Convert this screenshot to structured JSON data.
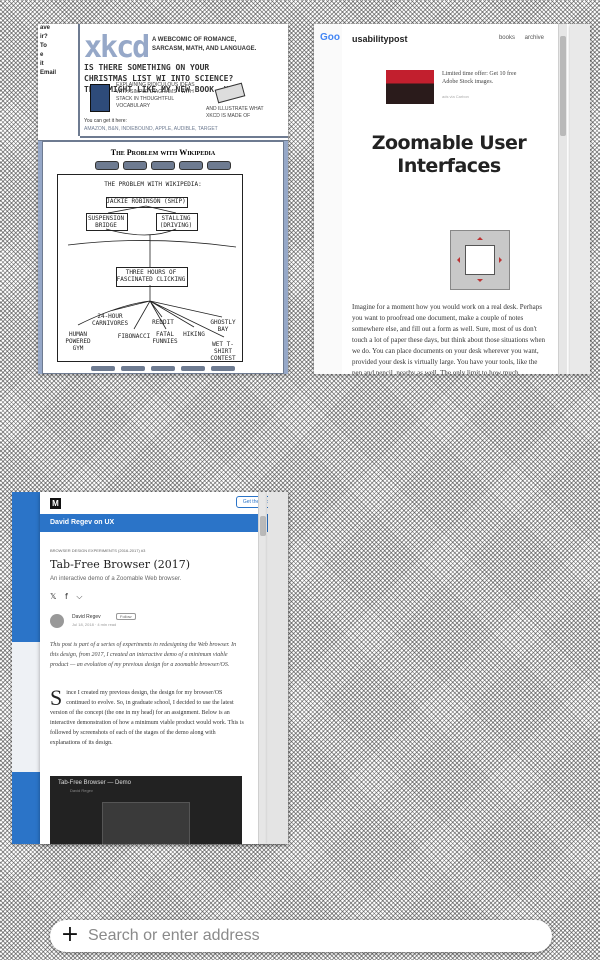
{
  "windows": {
    "xkcd": {
      "sidebar_lines": [
        "ave",
        "ir?",
        "",
        "To",
        "e",
        "it",
        "Email"
      ],
      "logo": "xkcd",
      "tagline": "A webcomic of romance, sarcasm, math, and language.",
      "ad_text": "Is there something on your Christmas list wi into science? They might like my new book, H",
      "ad_small": "Explaining ridiculous ideas with simple diagrams - with stack in thoughtful vocabulary",
      "ad_small2": "and illustrate what XKCD is made of",
      "buy_label": "You can get it here:",
      "buy_links": "Amazon, B&N, IndieBound, Apple, Audible, Target",
      "comic_title": "The Problem with Wikipedia",
      "comic": {
        "heading": "The problem with Wikipedia:",
        "n1": "Jackie Robinson (ship)",
        "n2": "Suspension bridge",
        "n3": "Stalling (driving)",
        "middle": "Three hours of fascinated clicking",
        "b1": "Human powered gym",
        "b2": "24-hour carnivores",
        "b3": "Fibonacci",
        "b4": "Fatal funnies",
        "b5": "Reddit",
        "b6": "Hiking",
        "b7": "Ghostly bay",
        "b8": "Wet t-shirt contest"
      }
    },
    "usability": {
      "google_mark": "Goo",
      "site_name": "usabilitypost",
      "nav": [
        "books",
        "archive"
      ],
      "ad_text": "Limited time offer: Get 10 free Adobe Stock images.",
      "ad_small": "ads via Carbon",
      "title": "Zoomable User Interfaces",
      "body": "Imagine for a moment how you would work on a real desk. Perhaps you want to proofread one document, make a couple of notes somewhere else, and fill out a form as well. Sure, most of us don't touch a lot of paper these days, but think about those situations when we do. You can place documents on your desk wherever you want, provided your desk is virtually large. You have your tools, like the pen and pencil, nearby as well. The only limit to how much"
    },
    "regev": {
      "medium_logo": "M",
      "get_app": "Get the app",
      "publication": "David Regev on UX",
      "meta": "Browser design experiments (2016-2017) #3",
      "title": "Tab-Free Browser (2017)",
      "subtitle": "An interactive demo of a Zoomable Web browser.",
      "share_icons": [
        "𝕏",
        "f",
        "⌵"
      ],
      "author": "David Regev",
      "follow": "Follow",
      "date": "Jul 18, 2018 · 4 min read",
      "italic_intro": "This post is part of a series of experiments in redesigning the Web browser. In this design, from 2017, I created an interactive demo of a minimum viable product — an evolution of my previous design for a zoomable browser/OS.",
      "drop_cap": "S",
      "para": "ince I created my previous design, the design for my browser/OS continued to evolve. So, in graduate school, I decided to use the latest version of the concept (the one in my head) for an assignment. Below is an interactive demonstration of how a minimum viable product would work. This is followed by screenshots of each of the stages of the demo along with explanations of its design.",
      "video_title": "Tab-Free Browser — Demo",
      "video_sub": "David Regev"
    }
  },
  "address_bar": {
    "placeholder": "Search or enter address",
    "new_icon": "+"
  }
}
